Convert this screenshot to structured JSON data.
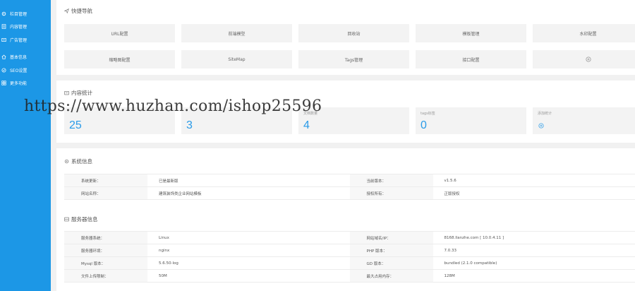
{
  "sidebar": {
    "items": [
      {
        "label": "栏目管理",
        "icon": "gear-icon"
      },
      {
        "label": "内容管理",
        "icon": "document-icon"
      },
      {
        "label": "广告管理",
        "icon": "ad-icon"
      },
      {
        "label": "基本信息",
        "icon": "home-icon"
      },
      {
        "label": "SEO设置",
        "icon": "seo-icon"
      },
      {
        "label": "更多功能",
        "icon": "grid-icon"
      }
    ]
  },
  "quick_nav": {
    "title": "快捷导航",
    "icon": "send-icon",
    "buttons": [
      "URL配置",
      "前端模型",
      "回收站",
      "模板管理",
      "水印配置",
      "缩略图配置",
      "SiteMap",
      "Tags管理",
      "接口配置",
      "+"
    ]
  },
  "content_stats": {
    "title": "内容统计",
    "icon": "folder-icon",
    "cards": [
      {
        "label": "",
        "value": "25"
      },
      {
        "label": "",
        "value": "3"
      },
      {
        "label": "文档数量",
        "value": "4"
      },
      {
        "label": "tags标签",
        "value": "0"
      },
      {
        "label": "添加统计",
        "value": "+"
      }
    ]
  },
  "system_info": {
    "title": "系统信息",
    "icon": "gear-icon",
    "rows": [
      [
        "系统更新：",
        "已是最新版",
        "当前版本：",
        "v1.5.6"
      ],
      [
        "网站名称：",
        "建筑装饰类企业网站模板",
        "授权所有：",
        "正版授权"
      ]
    ]
  },
  "server_info": {
    "title": "服务器信息",
    "icon": "server-icon",
    "rows": [
      [
        "服务器系统：",
        "Linux",
        "网站域名/IP：",
        "8168.llanzhe.com [ 10.0.4.11 ]"
      ],
      [
        "服务器环境：",
        "nginx",
        "PHP 版本：",
        "7.0.33"
      ],
      [
        "Mysql 版本：",
        "5.6.50-log",
        "GD 版本：",
        "bundled (2.1.0 compatible)"
      ],
      [
        "文件上传限制：",
        "50M",
        "最大占用内存：",
        "128M"
      ]
    ]
  },
  "watermark": "https://www.huzhan.com/ishop25596",
  "colors": {
    "sidebar": "#1c97e6",
    "accent": "#2a9be8",
    "background": "#f1f1f1"
  }
}
